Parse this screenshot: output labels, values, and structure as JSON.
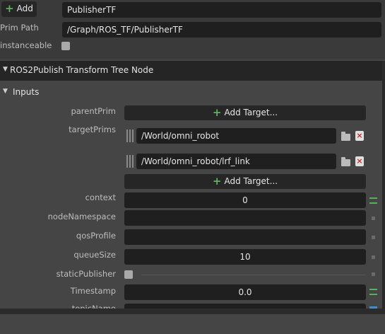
{
  "header": {
    "add_label": "Add",
    "prim_name_value": "PublisherTF",
    "prim_path_label": "Prim Path",
    "prim_path_value": "/Graph/ROS_TF/PublisherTF",
    "instanceable_label": "instanceable"
  },
  "section": {
    "title": "ROS2Publish Transform Tree Node",
    "inputs_title": "Inputs"
  },
  "inputs": {
    "parent_prim_label": "parentPrim",
    "add_target_label": "Add Target...",
    "target_prims_label": "targetPrims",
    "target_paths": [
      "/World/omni_robot",
      "/World/omni_robot/lrf_link"
    ],
    "add_target_label_2": "Add Target...",
    "context_label": "context",
    "context_value": "0",
    "node_namespace_label": "nodeNamespace",
    "node_namespace_value": "",
    "qos_profile_label": "qosProfile",
    "qos_profile_value": "",
    "queue_size_label": "queueSize",
    "queue_size_value": "10",
    "static_publisher_label": "staticPublisher",
    "timestamp_label": "Timestamp",
    "timestamp_value": "0.0",
    "topic_name_label": "topicName"
  },
  "colors": {
    "accent_green": "#55b255",
    "remove_red": "#c62828",
    "panel_bg": "#454545",
    "field_bg": "#1f1f1f"
  }
}
